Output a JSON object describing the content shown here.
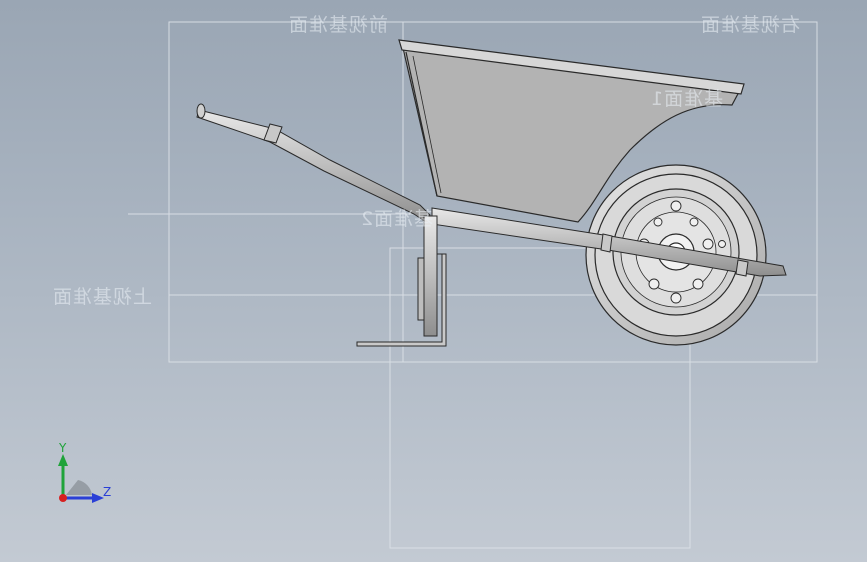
{
  "planes": {
    "front": "前视基准面",
    "right": "右视基准面",
    "top": "上视基准面",
    "plane1": "基准面1",
    "plane2": "基准面2"
  },
  "triad": {
    "y_label": "Y",
    "z_label": "Z"
  },
  "colors": {
    "background_top": "#9aa6b4",
    "background_bottom": "#c3cad3",
    "plane_outline": "#d8dde3",
    "part_fill": "#b4b4b4",
    "part_edge": "#2a2a2a",
    "y_axis": "#1fa33a",
    "z_axis": "#2a3fd6",
    "x_origin": "#d62020"
  }
}
